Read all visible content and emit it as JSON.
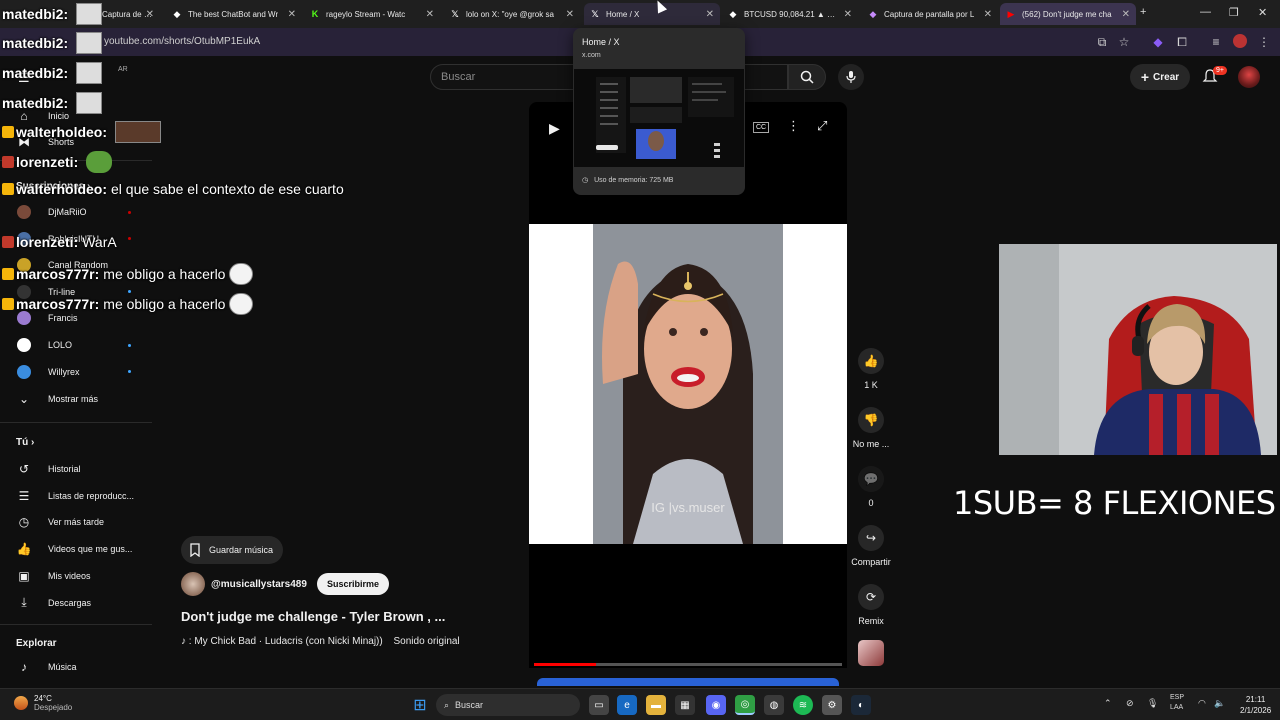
{
  "browser": {
    "tabs": [
      {
        "label": "Captura de pantalla por L",
        "icon": "capture-icon",
        "color": "#c58af9"
      },
      {
        "label": "The best ChatBot and Wr",
        "icon": "chatbot-icon",
        "color": "#ffffff"
      },
      {
        "label": "rageylo Stream - Watc",
        "icon": "kick-icon",
        "color": "#53fc18"
      },
      {
        "label": "lolo on X: \"oye @grok sa",
        "icon": "x-icon",
        "color": "#ffffff"
      },
      {
        "label": "Home / X",
        "icon": "x-icon",
        "color": "#ffffff"
      },
      {
        "label": "BTCUSD 90,084.21 ▲ +0.2",
        "icon": "tradingview-icon",
        "color": "#ffffff"
      },
      {
        "label": "Captura de pantalla por L",
        "icon": "capture-icon",
        "color": "#c58af9"
      },
      {
        "label": "(562) Don't judge me cha",
        "icon": "youtube-icon",
        "color": "#ff0000"
      }
    ],
    "url": "youtube.com/shorts/OtubMP1EukA",
    "tab_preview": {
      "title": "Home / X",
      "domain": "x.com",
      "memory": "Uso de memoria: 725 MB"
    }
  },
  "youtube": {
    "search_placeholder": "Buscar",
    "create_label": "Crear",
    "notification_count": "9+",
    "region": "AR",
    "sidebar": {
      "main": [
        {
          "label": "Inicio",
          "icon": "home-icon"
        },
        {
          "label": "Shorts",
          "icon": "shorts-icon"
        }
      ],
      "subs_heading": "Suscripciones",
      "subscriptions": [
        {
          "label": "DjMaRiiO",
          "color": "#7a4a3a",
          "live": "red"
        },
        {
          "label": "RobleisIUTU",
          "color": "#4a6fa5",
          "live": "red"
        },
        {
          "label": "Canal Random",
          "color": "#c9a227",
          "live": "none"
        },
        {
          "label": "Tri-line",
          "color": "#333333",
          "live": "dot"
        },
        {
          "label": "Francis",
          "color": "#9b7bd1",
          "live": "none"
        },
        {
          "label": "LOLO",
          "color": "#ffffff",
          "live": "dot"
        },
        {
          "label": "Willyrex",
          "color": "#3a8de0",
          "live": "dot"
        }
      ],
      "show_more": "Mostrar más",
      "you_heading": "Tú",
      "you_items": [
        {
          "label": "Historial",
          "icon": "history-icon"
        },
        {
          "label": "Listas de reproducc...",
          "icon": "playlists-icon"
        },
        {
          "label": "Ver más tarde",
          "icon": "watch-later-icon"
        },
        {
          "label": "Videos que me gus...",
          "icon": "like-icon"
        },
        {
          "label": "Mis videos",
          "icon": "my-videos-icon"
        },
        {
          "label": "Descargas",
          "icon": "download-icon"
        }
      ],
      "explore_heading": "Explorar",
      "explore_items": [
        {
          "label": "Música",
          "icon": "music-icon"
        }
      ]
    },
    "short": {
      "watermark": "IG |vs.muser",
      "progress_fraction": 0.2,
      "save_music": "Guardar música",
      "channel": "@musicallystars489",
      "subscribe": "Suscribirme",
      "title": "Don't judge me challenge - Tyler Brown , ...",
      "music": "♪ : My Chick Bad · Ludacris (con Nicki Minaj))",
      "sound": "Sonido original",
      "actions": {
        "like_count": "1 K",
        "dislike_label": "No me ...",
        "comments_count": "0",
        "share_label": "Compartir",
        "remix_label": "Remix"
      }
    }
  },
  "stream_overlay": {
    "caption": "1SUB= 8 FLEXIONES",
    "chat": [
      {
        "user": "matedbi2:",
        "message": "",
        "emote": true
      },
      {
        "user": "matedbi2:",
        "message": "",
        "emote": true
      },
      {
        "user": "matedbi2:",
        "message": "",
        "emote": true
      },
      {
        "user": "matedbi2:",
        "message": "",
        "emote": true
      },
      {
        "user": "walterholdeo:",
        "message": "",
        "emote": true
      },
      {
        "user": "lorenzeti:",
        "message": "",
        "emote": true
      },
      {
        "user": "walterholdeo:",
        "message": "el que sabe el contexto de ese cuarto",
        "emote": false
      },
      {
        "user": "lorenzeti:",
        "message": "WarA",
        "emote": false
      },
      {
        "user": "marcos777r:",
        "message": "me obligo a hacerlo",
        "emote": true
      },
      {
        "user": "marcos777r:",
        "message": "me obligo a hacerlo",
        "emote": true
      }
    ]
  },
  "taskbar": {
    "weather_temp": "24°C",
    "weather_desc": "Despejado",
    "search": "Buscar",
    "lang": "ESP",
    "lang2": "LAA",
    "time": "21:11",
    "date": "2/1/2026"
  }
}
